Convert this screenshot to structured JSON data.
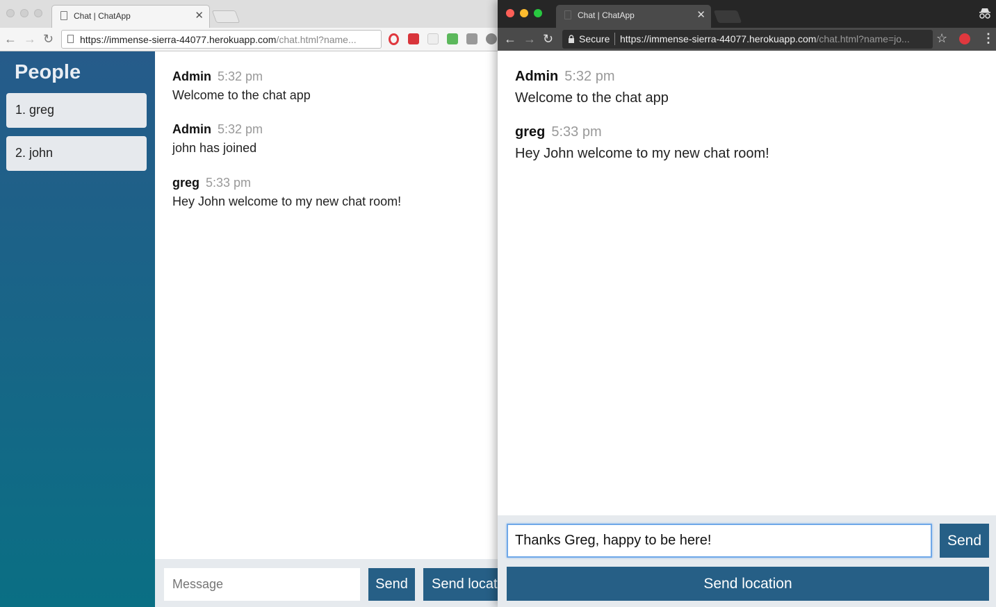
{
  "left_window": {
    "tab_title": "Chat | ChatApp",
    "url_host": "https://immense-sierra-44077.herokuapp.com",
    "url_path": "/chat.html?name...",
    "sidebar": {
      "heading": "People",
      "people": [
        "1. greg",
        "2. john"
      ]
    },
    "messages": [
      {
        "from": "Admin",
        "time": "5:32 pm",
        "text": "Welcome to the chat app"
      },
      {
        "from": "Admin",
        "time": "5:32 pm",
        "text": "john has joined"
      },
      {
        "from": "greg",
        "time": "5:33 pm",
        "text": "Hey John welcome to my new chat room!"
      }
    ],
    "footer": {
      "message_placeholder": "Message",
      "send_label": "Send",
      "send_location_label": "Send locatio"
    }
  },
  "right_window": {
    "tab_title": "Chat | ChatApp",
    "secure_label": "Secure",
    "url_host": "https://immense-sierra-44077.herokuapp.com",
    "url_path": "/chat.html?name=jo...",
    "messages": [
      {
        "from": "Admin",
        "time": "5:32 pm",
        "text": "Welcome to the chat app"
      },
      {
        "from": "greg",
        "time": "5:33 pm",
        "text": "Hey John welcome to my new chat room!"
      }
    ],
    "footer": {
      "message_value": "Thanks Greg, happy to be here!",
      "send_label": "Send",
      "send_location_label": "Send location"
    }
  },
  "colors": {
    "sidebar_top": "#265b8a",
    "sidebar_bottom": "#0a6f84",
    "button": "#265f86",
    "input_focus": "#6fa8e8"
  },
  "icons": [
    "back-arrow-icon",
    "forward-arrow-icon",
    "reload-icon",
    "page-icon",
    "lock-icon",
    "star-icon",
    "incognito-icon",
    "menu-dots-icon",
    "close-icon"
  ]
}
